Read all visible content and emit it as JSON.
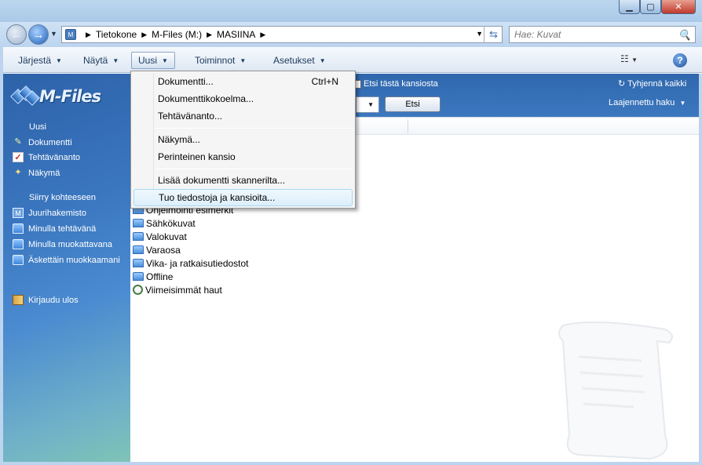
{
  "address": {
    "crumbs": [
      "Tietokone",
      "M-Files (M:)",
      "MASIINA"
    ],
    "search_placeholder": "Hae: Kuvat"
  },
  "commandbar": {
    "items": [
      "Järjestä",
      "Näytä",
      "Uusi",
      "Toiminnot",
      "Asetukset"
    ],
    "help": "?"
  },
  "sidebar": {
    "logo": "M-Files",
    "new_header": "Uusi",
    "new_items": [
      "Dokumentti",
      "Tehtävänanto",
      "Näkymä"
    ],
    "goto_header": "Siirry kohteeseen",
    "goto_items": [
      "Juurihakemisto",
      "Minulla tehtävänä",
      "Minulla muokattavana",
      "Äskettäin muokkaamani"
    ],
    "logout": "Kirjaudu ulos"
  },
  "searchstrip": {
    "checkbox_label": "Etsi tästä kansiosta",
    "search_button": "Etsi",
    "clear_all": "Tyhjennä kaikki",
    "advanced": "Laajennettu haku"
  },
  "list": {
    "partial_item": "Ohjelmointi esimerkit",
    "items": [
      "Sähkökuvat",
      "Valokuvat",
      "Varaosa",
      "Vika- ja ratkaisutiedostot",
      "Offline"
    ],
    "recent_searches": "Viimeisimmät haut"
  },
  "menu": {
    "items": [
      {
        "label": "Dokumentti...",
        "shortcut": "Ctrl+N"
      },
      {
        "label": "Dokumenttikokoelma...",
        "shortcut": ""
      },
      {
        "label": "Tehtävänanto...",
        "shortcut": ""
      },
      {
        "label": "Näkymä...",
        "shortcut": ""
      },
      {
        "label": "Perinteinen kansio",
        "shortcut": ""
      },
      {
        "label": "Lisää dokumentti skannerilta...",
        "shortcut": ""
      },
      {
        "label": "Tuo tiedostoja ja kansioita...",
        "shortcut": ""
      }
    ]
  }
}
